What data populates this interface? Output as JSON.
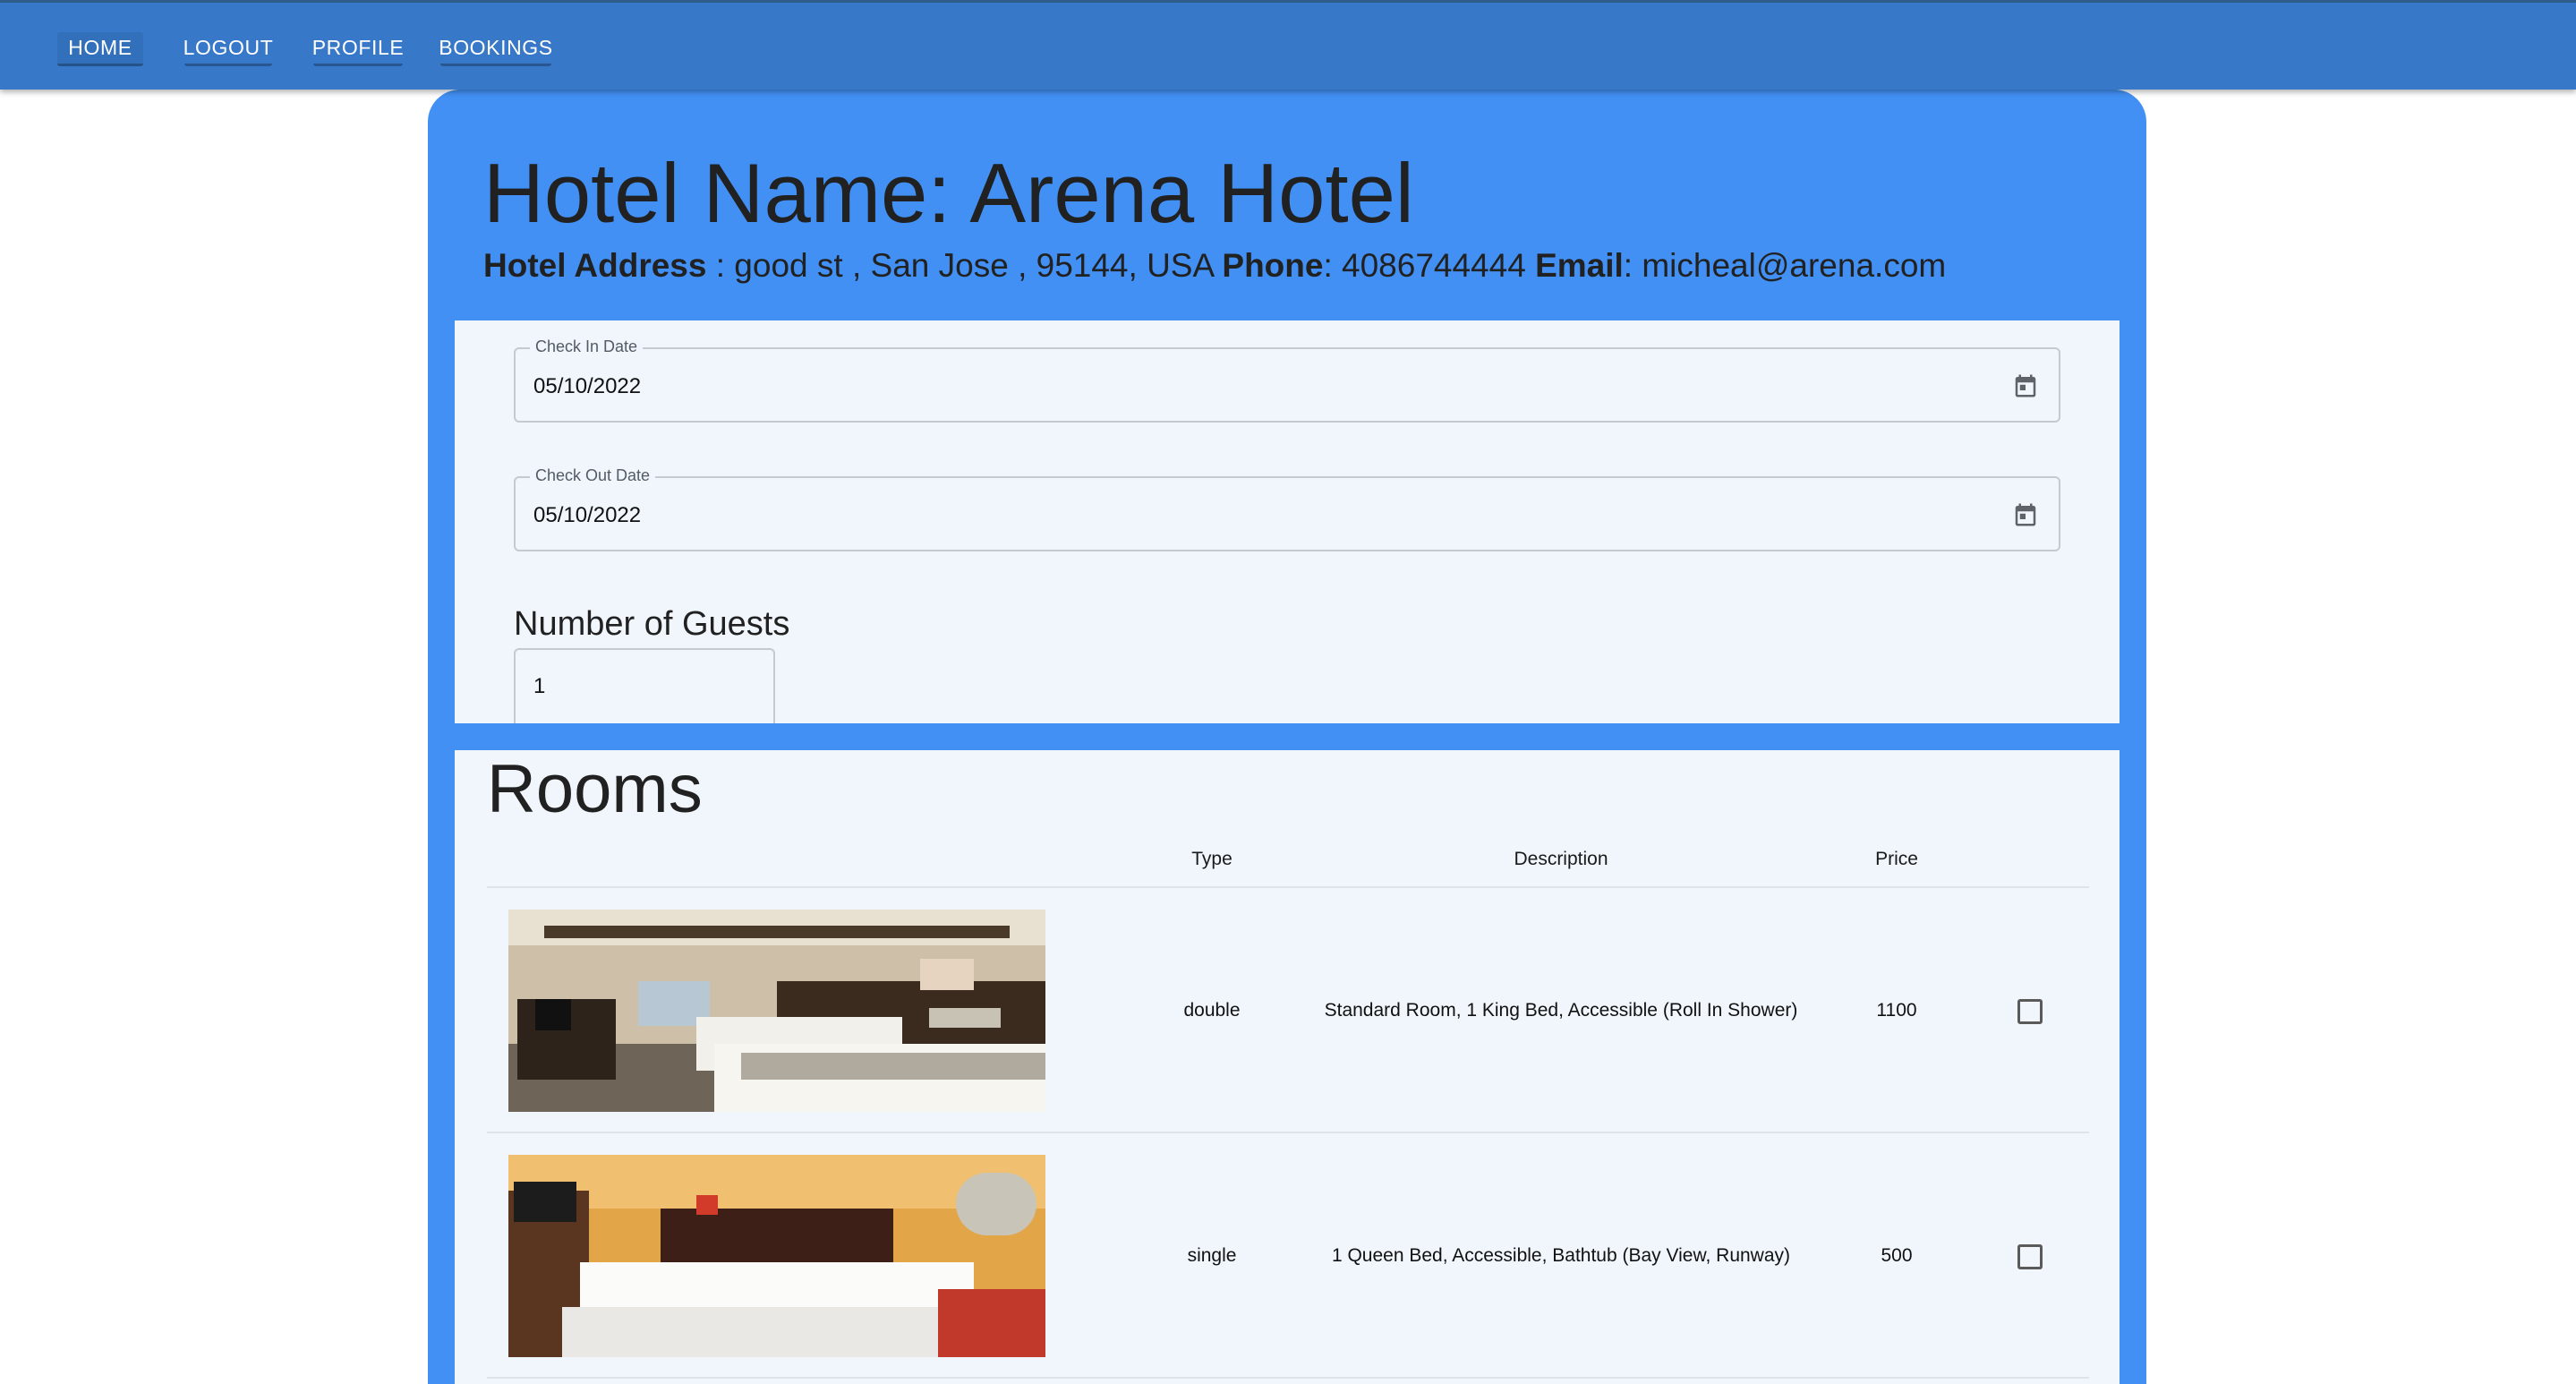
{
  "nav": {
    "home": "HOME",
    "logout": "LOGOUT",
    "profile": "PROFILE",
    "bookings": "BOOKINGS"
  },
  "hotel": {
    "title": "Hotel Name: Arena Hotel",
    "address_label": "Hotel Address",
    "address_value": " : good st , San Jose , 95144, USA ",
    "phone_label": "Phone",
    "phone_value": ": 4086744444 ",
    "email_label": "Email",
    "email_value": ": micheal@arena.com"
  },
  "form": {
    "check_in_label": "Check In Date",
    "check_in_value": "05/10/2022",
    "check_out_label": "Check Out Date",
    "check_out_value": "05/10/2022",
    "guests_label": "Number of Guests",
    "guests_value": "1",
    "calendar_icon": "calendar-icon"
  },
  "rooms": {
    "title": "Rooms",
    "columns": [
      "Type",
      "Description",
      "Price"
    ],
    "rows": [
      {
        "type": "double",
        "description": "Standard Room, 1 King Bed, Accessible (Roll In Shower)",
        "price": "1100",
        "checked": false
      },
      {
        "type": "single",
        "description": "1 Queen Bed, Accessible, Bathtub (Bay View, Runway)",
        "price": "500",
        "checked": false
      }
    ]
  },
  "colors": {
    "appbar": "#3778c8",
    "card": "#4290f4",
    "panel": "#f0f6fc"
  }
}
